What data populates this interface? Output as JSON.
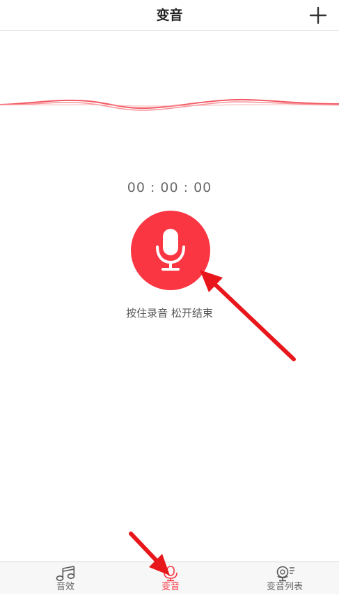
{
  "header": {
    "title": "变音",
    "plus_icon": "plus-icon"
  },
  "recorder": {
    "timer": "00 : 00 : 00",
    "mic_icon": "microphone-icon",
    "hint": "按住录音  松开结束"
  },
  "tabs": [
    {
      "label": "音效",
      "icon": "music-note-icon",
      "active": false
    },
    {
      "label": "变音",
      "icon": "microphone-icon",
      "active": true
    },
    {
      "label": "变音列表",
      "icon": "voice-list-icon",
      "active": false
    }
  ],
  "colors": {
    "accent": "#fa3643",
    "annotation_arrow": "#e8171b",
    "text_primary": "#222222",
    "text_secondary": "#666666",
    "tabbar_bg": "#f7f7f7"
  }
}
